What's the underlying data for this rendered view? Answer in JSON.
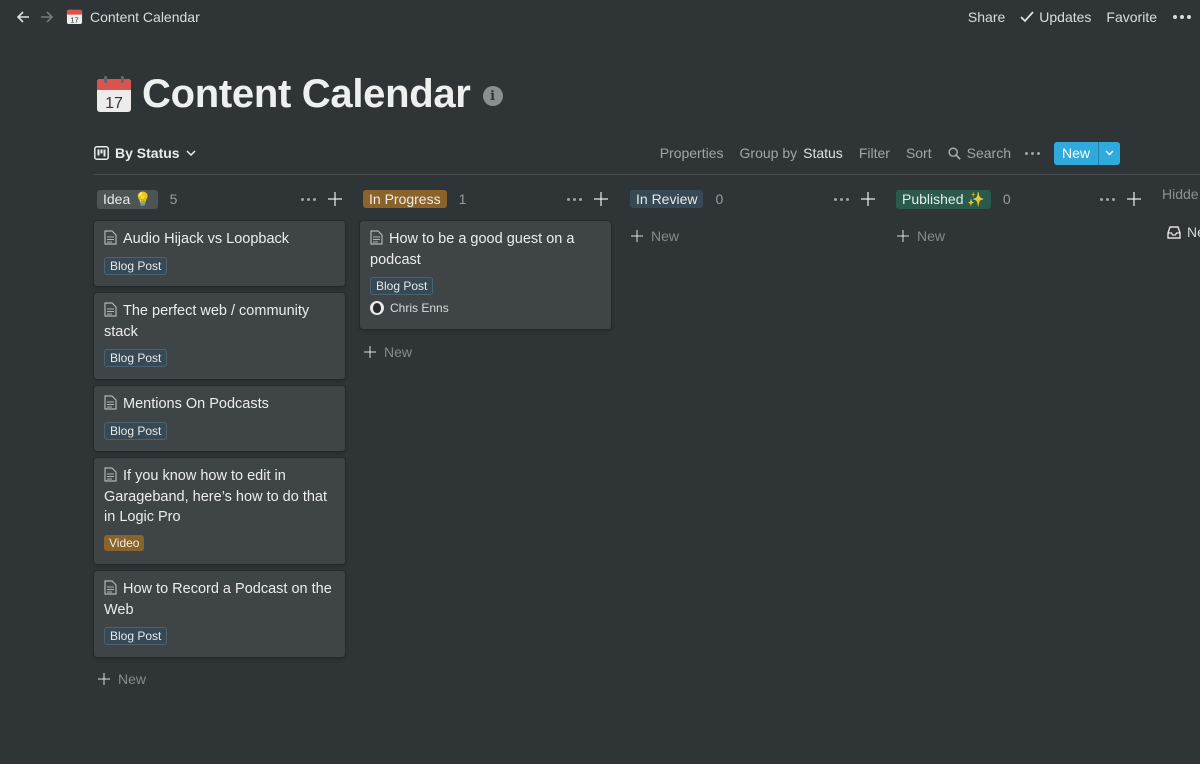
{
  "topbar": {
    "breadcrumb": "Content Calendar",
    "share": "Share",
    "updates": "Updates",
    "favorite": "Favorite"
  },
  "page": {
    "title": "Content Calendar"
  },
  "view": {
    "name": "By Status",
    "properties": "Properties",
    "group_by_prefix": "Group by",
    "group_by_value": "Status",
    "filter": "Filter",
    "sort": "Sort",
    "search": "Search",
    "new": "New"
  },
  "columns": [
    {
      "label": "Idea 💡",
      "count": "5",
      "color": "#4e5356",
      "cards": [
        {
          "title": "Audio Hijack vs Loopback",
          "tag": "Blog Post"
        },
        {
          "title": "The perfect web / community stack",
          "tag": "Blog Post"
        },
        {
          "title": "Mentions On Podcasts",
          "tag": "Blog Post"
        },
        {
          "title": "If you know how to edit in Garageband, here’s how to do that in Logic Pro",
          "tag": "Video"
        },
        {
          "title": "How to Record a Podcast on the Web",
          "tag": "Blog Post"
        }
      ],
      "new_label": "New"
    },
    {
      "label": "In Progress",
      "count": "1",
      "color": "#89632a",
      "cards": [
        {
          "title": "How to be a good guest on a podcast",
          "tag": "Blog Post",
          "person": "Chris Enns"
        }
      ],
      "new_label": "New"
    },
    {
      "label": "In Review",
      "count": "0",
      "color": "#364954",
      "cards": [],
      "new_label": "New"
    },
    {
      "label": "Published ✨",
      "count": "0",
      "color": "#2b594c",
      "cards": [],
      "new_label": "New"
    }
  ],
  "hidden": {
    "label": "Hidde",
    "item": "Ne"
  },
  "colors": {
    "background": "#2f3437",
    "card": "#3f4447",
    "accent": "#2eaadc"
  }
}
